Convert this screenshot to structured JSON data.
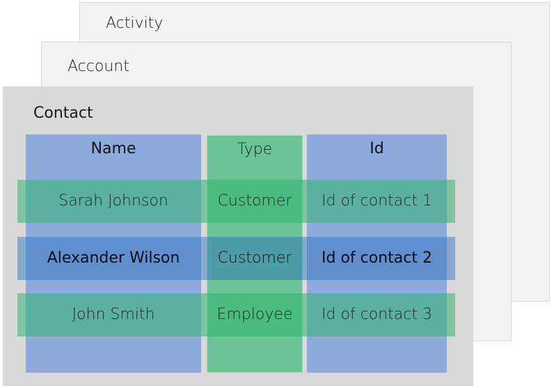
{
  "cards": {
    "activity": {
      "title": "Activity"
    },
    "account": {
      "title": "Account"
    },
    "contact": {
      "title": "Contact"
    }
  },
  "table": {
    "columns": [
      {
        "label": "Name"
      },
      {
        "label": "Type"
      },
      {
        "label": "Id"
      }
    ],
    "rows": [
      {
        "name": "Sarah Johnson",
        "type": "Customer",
        "id": "Id of contact 1",
        "highlight": "green"
      },
      {
        "name": "Alexander Wilson",
        "type": "Customer",
        "id": "Id of contact 2",
        "highlight": "blue"
      },
      {
        "name": "John Smith",
        "type": "Employee",
        "id": "Id of contact 3",
        "highlight": "green"
      }
    ]
  },
  "colors": {
    "card_background": "#f2f2f2",
    "contact_background": "#d9d9d9",
    "column_blue": "#8eaadc",
    "column_green": "#6bc495",
    "row_green_overlay": "#32b46e",
    "row_blue_overlay": "#286ebe"
  }
}
